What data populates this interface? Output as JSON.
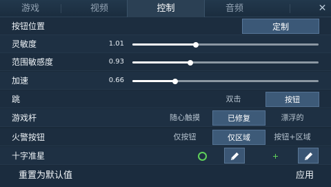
{
  "tabs": [
    {
      "label": "游戏",
      "active": false
    },
    {
      "label": "视频",
      "active": false
    },
    {
      "label": "控制",
      "active": true
    },
    {
      "label": "音频",
      "active": false
    }
  ],
  "close_label": "✕",
  "settings": {
    "button_position": {
      "label": "按钮位置",
      "button": "定制"
    },
    "sensitivity": {
      "label": "灵敏度",
      "value": "1.01",
      "fraction": 0.34
    },
    "range_sensitivity": {
      "label": "范围敏感度",
      "value": "0.93",
      "fraction": 0.31
    },
    "acceleration": {
      "label": "加速",
      "value": "0.66",
      "fraction": 0.23
    },
    "jump": {
      "label": "跳",
      "options": [
        "双击",
        "按钮"
      ],
      "selected": 1
    },
    "joystick": {
      "label": "游戏杆",
      "options": [
        "随心触摸",
        "已修复",
        "漂浮的"
      ],
      "selected": 1
    },
    "fire_button": {
      "label": "火警按钮",
      "options": [
        "仅按钮",
        "仅区域",
        "按钮+区域"
      ],
      "selected": 1
    },
    "crosshair": {
      "label": "十字准星"
    }
  },
  "footer": {
    "reset": "重置为默认值",
    "apply": "应用"
  },
  "colors": {
    "accent": "#3d5a78",
    "crosshair_green": "#5fd15a",
    "background": "#1a2a3a"
  }
}
